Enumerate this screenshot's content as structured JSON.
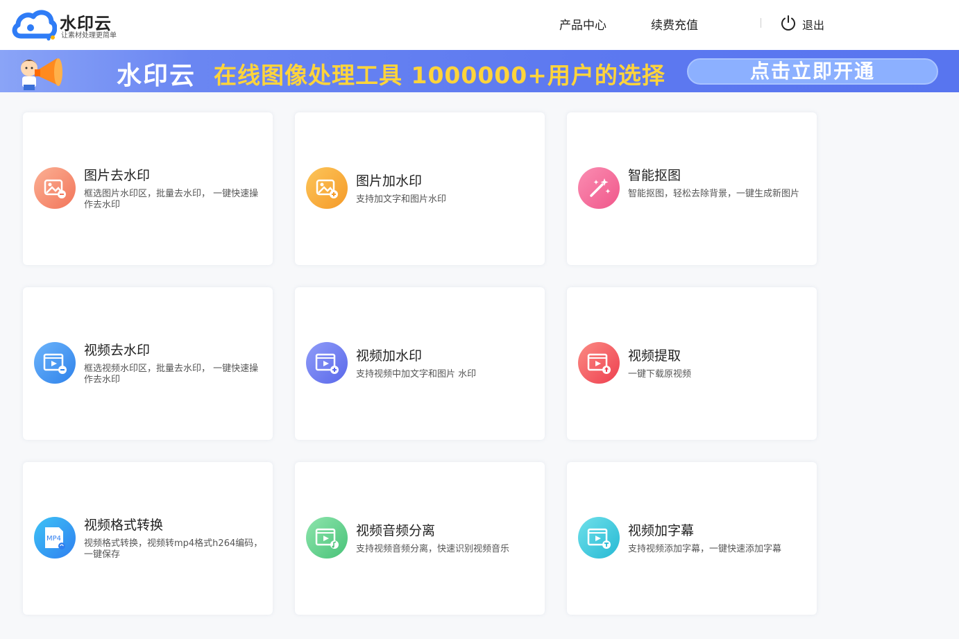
{
  "header": {
    "logo_name": "水印云",
    "logo_slogan": "让素材处理更简单",
    "nav": [
      "产品中心",
      "续费充值"
    ],
    "logout_label": "退出"
  },
  "banner": {
    "brand": "水印云",
    "tagline": "在线图像处理工具 1000000+用户的选择",
    "cta": "点击立即开通"
  },
  "colors": {
    "brand_blue": "#2f7cf6",
    "banner_bg": "#5d79f0",
    "banner_tagline": "#ffd43b"
  },
  "cards": [
    {
      "title": "图片去水印",
      "desc": "框选图片水印区，批量去水印， 一键快速操作去水印",
      "icon": "image-remove-icon",
      "color": "#f58a6f"
    },
    {
      "title": "图片加水印",
      "desc": "支持加文字和图片水印",
      "icon": "image-add-icon",
      "color": "#f7ac3c"
    },
    {
      "title": "智能抠图",
      "desc": "智能抠图，轻松去除背景，一键生成新图片",
      "icon": "magic-wand-icon",
      "color": "#f56f9d"
    },
    {
      "title": "视频去水印",
      "desc": "框选视频水印区，批量去水印， 一键快速操作去水印",
      "icon": "video-remove-icon",
      "color": "#3d93f2"
    },
    {
      "title": "视频加水印",
      "desc": "支持视频中加文字和图片 水印",
      "icon": "video-add-icon",
      "color": "#6d7df3"
    },
    {
      "title": "视频提取",
      "desc": "一键下载原视频",
      "icon": "video-extract-icon",
      "color": "#f35a5e"
    },
    {
      "title": "视频格式转换",
      "desc": "视频格式转换，视频转mp4格式h264编码，一键保存",
      "icon": "mp4-convert-icon",
      "color": "#2f86f0",
      "icon_text": "MP4"
    },
    {
      "title": "视频音频分离",
      "desc": "支持视频音频分离，快速识别视频音乐",
      "icon": "audio-separate-icon",
      "color": "#5fcf8a"
    },
    {
      "title": "视频加字幕",
      "desc": "支持视频添加字幕，一键快速添加字幕",
      "icon": "subtitle-icon",
      "color": "#3cc8d8"
    }
  ]
}
